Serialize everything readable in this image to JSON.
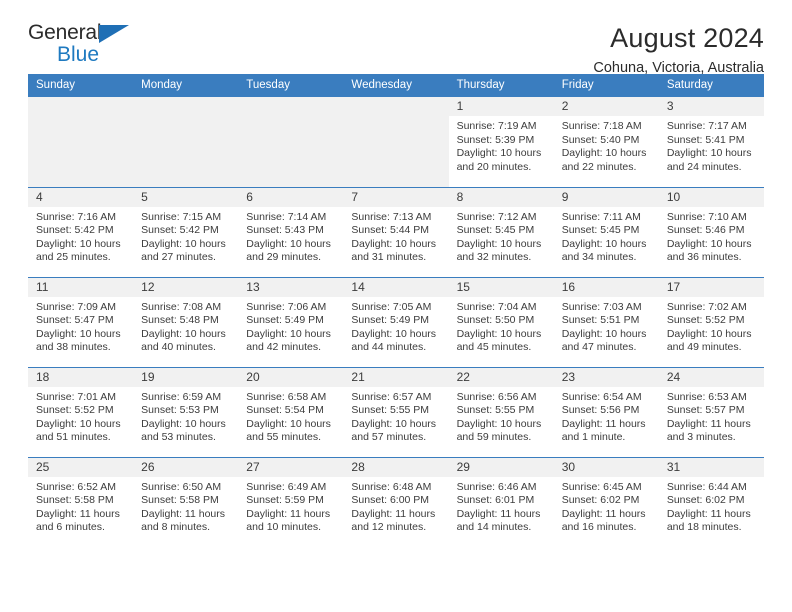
{
  "logo": {
    "word_one": "General",
    "word_two": "Blue",
    "triangle_icon": "triangle-icon",
    "accent_color": "#1f7ac0"
  },
  "header": {
    "title": "August 2024",
    "subtitle": "Cohuna, Victoria, Australia"
  },
  "calendar": {
    "header_color": "#3a7dbf",
    "weekday_headers": [
      "Sunday",
      "Monday",
      "Tuesday",
      "Wednesday",
      "Thursday",
      "Friday",
      "Saturday"
    ],
    "weeks": [
      [
        {
          "day": "",
          "empty": true
        },
        {
          "day": "",
          "empty": true
        },
        {
          "day": "",
          "empty": true
        },
        {
          "day": "",
          "empty": true
        },
        {
          "day": "1",
          "sunrise": "Sunrise: 7:19 AM",
          "sunset": "Sunset: 5:39 PM",
          "daylight_1": "Daylight: 10 hours",
          "daylight_2": "and 20 minutes."
        },
        {
          "day": "2",
          "sunrise": "Sunrise: 7:18 AM",
          "sunset": "Sunset: 5:40 PM",
          "daylight_1": "Daylight: 10 hours",
          "daylight_2": "and 22 minutes."
        },
        {
          "day": "3",
          "sunrise": "Sunrise: 7:17 AM",
          "sunset": "Sunset: 5:41 PM",
          "daylight_1": "Daylight: 10 hours",
          "daylight_2": "and 24 minutes."
        }
      ],
      [
        {
          "day": "4",
          "sunrise": "Sunrise: 7:16 AM",
          "sunset": "Sunset: 5:42 PM",
          "daylight_1": "Daylight: 10 hours",
          "daylight_2": "and 25 minutes."
        },
        {
          "day": "5",
          "sunrise": "Sunrise: 7:15 AM",
          "sunset": "Sunset: 5:42 PM",
          "daylight_1": "Daylight: 10 hours",
          "daylight_2": "and 27 minutes."
        },
        {
          "day": "6",
          "sunrise": "Sunrise: 7:14 AM",
          "sunset": "Sunset: 5:43 PM",
          "daylight_1": "Daylight: 10 hours",
          "daylight_2": "and 29 minutes."
        },
        {
          "day": "7",
          "sunrise": "Sunrise: 7:13 AM",
          "sunset": "Sunset: 5:44 PM",
          "daylight_1": "Daylight: 10 hours",
          "daylight_2": "and 31 minutes."
        },
        {
          "day": "8",
          "sunrise": "Sunrise: 7:12 AM",
          "sunset": "Sunset: 5:45 PM",
          "daylight_1": "Daylight: 10 hours",
          "daylight_2": "and 32 minutes."
        },
        {
          "day": "9",
          "sunrise": "Sunrise: 7:11 AM",
          "sunset": "Sunset: 5:45 PM",
          "daylight_1": "Daylight: 10 hours",
          "daylight_2": "and 34 minutes."
        },
        {
          "day": "10",
          "sunrise": "Sunrise: 7:10 AM",
          "sunset": "Sunset: 5:46 PM",
          "daylight_1": "Daylight: 10 hours",
          "daylight_2": "and 36 minutes."
        }
      ],
      [
        {
          "day": "11",
          "sunrise": "Sunrise: 7:09 AM",
          "sunset": "Sunset: 5:47 PM",
          "daylight_1": "Daylight: 10 hours",
          "daylight_2": "and 38 minutes."
        },
        {
          "day": "12",
          "sunrise": "Sunrise: 7:08 AM",
          "sunset": "Sunset: 5:48 PM",
          "daylight_1": "Daylight: 10 hours",
          "daylight_2": "and 40 minutes."
        },
        {
          "day": "13",
          "sunrise": "Sunrise: 7:06 AM",
          "sunset": "Sunset: 5:49 PM",
          "daylight_1": "Daylight: 10 hours",
          "daylight_2": "and 42 minutes."
        },
        {
          "day": "14",
          "sunrise": "Sunrise: 7:05 AM",
          "sunset": "Sunset: 5:49 PM",
          "daylight_1": "Daylight: 10 hours",
          "daylight_2": "and 44 minutes."
        },
        {
          "day": "15",
          "sunrise": "Sunrise: 7:04 AM",
          "sunset": "Sunset: 5:50 PM",
          "daylight_1": "Daylight: 10 hours",
          "daylight_2": "and 45 minutes."
        },
        {
          "day": "16",
          "sunrise": "Sunrise: 7:03 AM",
          "sunset": "Sunset: 5:51 PM",
          "daylight_1": "Daylight: 10 hours",
          "daylight_2": "and 47 minutes."
        },
        {
          "day": "17",
          "sunrise": "Sunrise: 7:02 AM",
          "sunset": "Sunset: 5:52 PM",
          "daylight_1": "Daylight: 10 hours",
          "daylight_2": "and 49 minutes."
        }
      ],
      [
        {
          "day": "18",
          "sunrise": "Sunrise: 7:01 AM",
          "sunset": "Sunset: 5:52 PM",
          "daylight_1": "Daylight: 10 hours",
          "daylight_2": "and 51 minutes."
        },
        {
          "day": "19",
          "sunrise": "Sunrise: 6:59 AM",
          "sunset": "Sunset: 5:53 PM",
          "daylight_1": "Daylight: 10 hours",
          "daylight_2": "and 53 minutes."
        },
        {
          "day": "20",
          "sunrise": "Sunrise: 6:58 AM",
          "sunset": "Sunset: 5:54 PM",
          "daylight_1": "Daylight: 10 hours",
          "daylight_2": "and 55 minutes."
        },
        {
          "day": "21",
          "sunrise": "Sunrise: 6:57 AM",
          "sunset": "Sunset: 5:55 PM",
          "daylight_1": "Daylight: 10 hours",
          "daylight_2": "and 57 minutes."
        },
        {
          "day": "22",
          "sunrise": "Sunrise: 6:56 AM",
          "sunset": "Sunset: 5:55 PM",
          "daylight_1": "Daylight: 10 hours",
          "daylight_2": "and 59 minutes."
        },
        {
          "day": "23",
          "sunrise": "Sunrise: 6:54 AM",
          "sunset": "Sunset: 5:56 PM",
          "daylight_1": "Daylight: 11 hours",
          "daylight_2": "and 1 minute."
        },
        {
          "day": "24",
          "sunrise": "Sunrise: 6:53 AM",
          "sunset": "Sunset: 5:57 PM",
          "daylight_1": "Daylight: 11 hours",
          "daylight_2": "and 3 minutes."
        }
      ],
      [
        {
          "day": "25",
          "sunrise": "Sunrise: 6:52 AM",
          "sunset": "Sunset: 5:58 PM",
          "daylight_1": "Daylight: 11 hours",
          "daylight_2": "and 6 minutes."
        },
        {
          "day": "26",
          "sunrise": "Sunrise: 6:50 AM",
          "sunset": "Sunset: 5:58 PM",
          "daylight_1": "Daylight: 11 hours",
          "daylight_2": "and 8 minutes."
        },
        {
          "day": "27",
          "sunrise": "Sunrise: 6:49 AM",
          "sunset": "Sunset: 5:59 PM",
          "daylight_1": "Daylight: 11 hours",
          "daylight_2": "and 10 minutes."
        },
        {
          "day": "28",
          "sunrise": "Sunrise: 6:48 AM",
          "sunset": "Sunset: 6:00 PM",
          "daylight_1": "Daylight: 11 hours",
          "daylight_2": "and 12 minutes."
        },
        {
          "day": "29",
          "sunrise": "Sunrise: 6:46 AM",
          "sunset": "Sunset: 6:01 PM",
          "daylight_1": "Daylight: 11 hours",
          "daylight_2": "and 14 minutes."
        },
        {
          "day": "30",
          "sunrise": "Sunrise: 6:45 AM",
          "sunset": "Sunset: 6:02 PM",
          "daylight_1": "Daylight: 11 hours",
          "daylight_2": "and 16 minutes."
        },
        {
          "day": "31",
          "sunrise": "Sunrise: 6:44 AM",
          "sunset": "Sunset: 6:02 PM",
          "daylight_1": "Daylight: 11 hours",
          "daylight_2": "and 18 minutes."
        }
      ]
    ]
  }
}
